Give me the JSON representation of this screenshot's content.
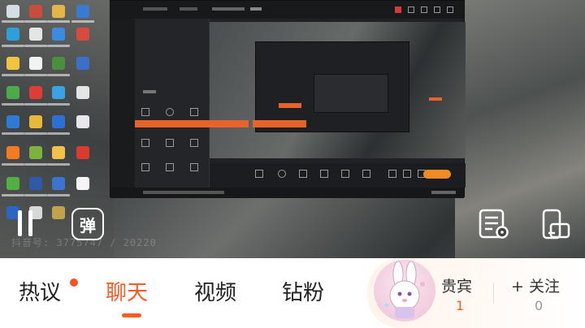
{
  "overlay": {
    "danmu_label": "弹",
    "ghost_watermark": "抖音号: 3775747 / 20220"
  },
  "tabs": [
    {
      "label": "热议",
      "active": false,
      "badge_dot": true
    },
    {
      "label": "聊天",
      "active": true,
      "badge_dot": false
    },
    {
      "label": "视频",
      "active": false,
      "badge_dot": false
    },
    {
      "label": "钻粉",
      "active": false,
      "badge_dot": false
    }
  ],
  "vip": {
    "guest_label": "贵宾",
    "guest_count": "1",
    "follow_label": "+ 关注",
    "follow_count": "0"
  },
  "colors": {
    "accent": "#ff5a1f",
    "orange_bar": "#e8632a"
  },
  "icons": {
    "pause": "pause-icon",
    "danmu": "danmu-icon",
    "message_list": "message-list-icon",
    "screen_rotate": "screen-rotate-icon"
  }
}
